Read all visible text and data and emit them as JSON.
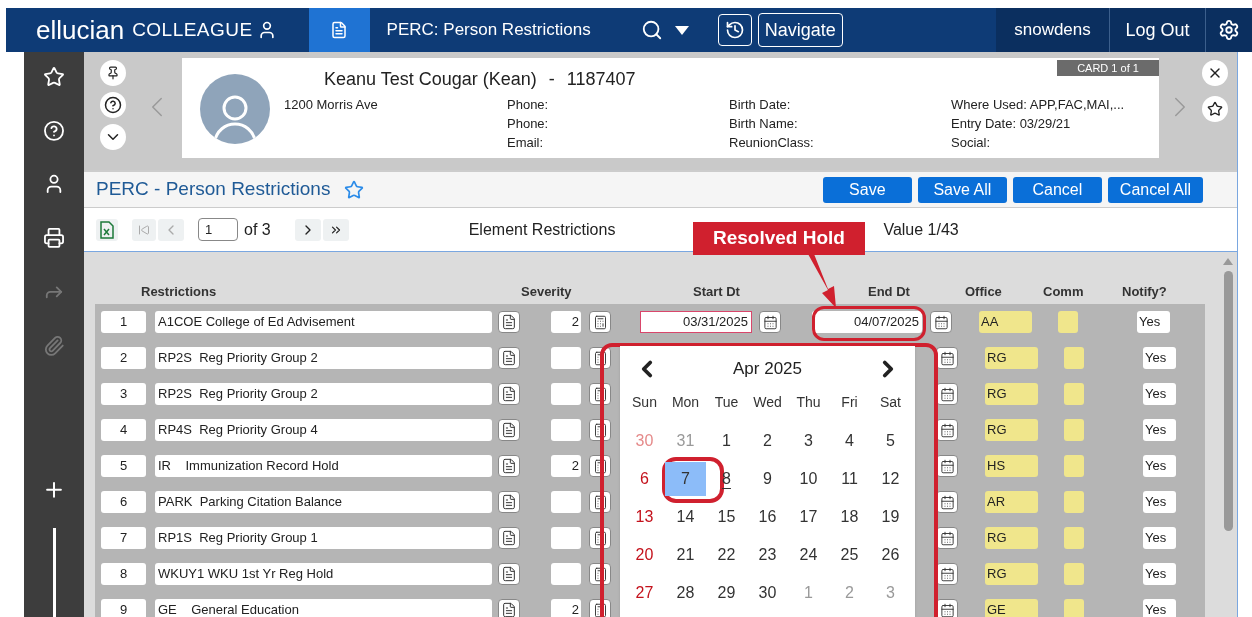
{
  "topbar": {
    "brand": "ellucian",
    "product": "COLLEAGUE",
    "form_title": "PERC: Person Restrictions",
    "navigate": "Navigate",
    "user": "snowdens",
    "logout": "Log Out"
  },
  "person": {
    "name": "Keanu Test Cougar (Kean)",
    "separator": "-",
    "id": "1187407",
    "card": "CARD 1 of 1",
    "address": "1200 Morris Ave",
    "columns": [
      [
        "Phone:",
        "Phone:",
        "Email:"
      ],
      [
        "Birth Date:",
        "Birth Name:",
        "ReunionClass:"
      ],
      [
        "Where Used: APP,FAC,MAI,...",
        "Entry Date: 03/29/21",
        "Social:"
      ]
    ]
  },
  "form": {
    "title": "PERC - Person Restrictions",
    "buttons": [
      "Save",
      "Save All",
      "Cancel",
      "Cancel All"
    ]
  },
  "pager": {
    "page": "1",
    "of": "of 3",
    "section": "Element Restrictions",
    "value": "Value 1/43"
  },
  "annotation": "Resolved Hold",
  "columns": [
    "Restrictions",
    "Severity",
    "Start Dt",
    "End Dt",
    "Office",
    "Comm",
    "Notify?"
  ],
  "rows": [
    {
      "num": "1",
      "restriction": "A1COE College of Ed Advisement",
      "severity": "2",
      "start_dt": "03/31/2025",
      "end_dt": "04/07/2025",
      "office": "AA",
      "notify": "Yes"
    },
    {
      "num": "2",
      "restriction": "RP2S  Reg Priority Group 2",
      "office": "RG",
      "notify": "Yes"
    },
    {
      "num": "3",
      "restriction": "RP2S  Reg Priority Group 2",
      "office": "RG",
      "notify": "Yes"
    },
    {
      "num": "4",
      "restriction": "RP4S  Reg Priority Group 4",
      "office": "RG",
      "notify": "Yes"
    },
    {
      "num": "5",
      "restriction": "IR    Immunization Record Hold",
      "severity": "2",
      "office": "HS",
      "notify": "Yes"
    },
    {
      "num": "6",
      "restriction": "PARK  Parking Citation Balance",
      "office": "AR",
      "notify": "Yes"
    },
    {
      "num": "7",
      "restriction": "RP1S  Reg Priority Group 1",
      "office": "RG",
      "notify": "Yes"
    },
    {
      "num": "8",
      "restriction": "WKUY1 WKU 1st Yr Reg Hold",
      "office": "RG",
      "notify": "Yes"
    },
    {
      "num": "9",
      "restriction": "GE    General Education",
      "severity": "2",
      "office": "GE",
      "notify": "Yes"
    }
  ],
  "calendar": {
    "month": "Apr 2025",
    "weekdays": [
      "Sun",
      "Mon",
      "Tue",
      "Wed",
      "Thu",
      "Fri",
      "Sat"
    ],
    "weeks": [
      [
        {
          "label": "30",
          "outside": true,
          "selected": false,
          "today": false
        },
        {
          "label": "31",
          "outside": true,
          "selected": false,
          "today": false
        },
        {
          "label": "1",
          "outside": false,
          "selected": false,
          "today": false
        },
        {
          "label": "2",
          "outside": false,
          "selected": false,
          "today": false
        },
        {
          "label": "3",
          "outside": false,
          "selected": false,
          "today": false
        },
        {
          "label": "4",
          "outside": false,
          "selected": false,
          "today": false
        },
        {
          "label": "5",
          "outside": false,
          "selected": false,
          "today": false
        }
      ],
      [
        {
          "label": "6",
          "outside": false,
          "selected": false,
          "today": false
        },
        {
          "label": "7",
          "outside": false,
          "selected": true,
          "today": false
        },
        {
          "label": "8",
          "outside": false,
          "selected": false,
          "today": true
        },
        {
          "label": "9",
          "outside": false,
          "selected": false,
          "today": false
        },
        {
          "label": "10",
          "outside": false,
          "selected": false,
          "today": false
        },
        {
          "label": "11",
          "outside": false,
          "selected": false,
          "today": false
        },
        {
          "label": "12",
          "outside": false,
          "selected": false,
          "today": false
        }
      ],
      [
        {
          "label": "13",
          "outside": false,
          "selected": false,
          "today": false
        },
        {
          "label": "14",
          "outside": false,
          "selected": false,
          "today": false
        },
        {
          "label": "15",
          "outside": false,
          "selected": false,
          "today": false
        },
        {
          "label": "16",
          "outside": false,
          "selected": false,
          "today": false
        },
        {
          "label": "17",
          "outside": false,
          "selected": false,
          "today": false
        },
        {
          "label": "18",
          "outside": false,
          "selected": false,
          "today": false
        },
        {
          "label": "19",
          "outside": false,
          "selected": false,
          "today": false
        }
      ],
      [
        {
          "label": "20",
          "outside": false,
          "selected": false,
          "today": false
        },
        {
          "label": "21",
          "outside": false,
          "selected": false,
          "today": false
        },
        {
          "label": "22",
          "outside": false,
          "selected": false,
          "today": false
        },
        {
          "label": "23",
          "outside": false,
          "selected": false,
          "today": false
        },
        {
          "label": "24",
          "outside": false,
          "selected": false,
          "today": false
        },
        {
          "label": "25",
          "outside": false,
          "selected": false,
          "today": false
        },
        {
          "label": "26",
          "outside": false,
          "selected": false,
          "today": false
        }
      ],
      [
        {
          "label": "27",
          "outside": false,
          "selected": false,
          "today": false
        },
        {
          "label": "28",
          "outside": false,
          "selected": false,
          "today": false
        },
        {
          "label": "29",
          "outside": false,
          "selected": false,
          "today": false
        },
        {
          "label": "30",
          "outside": false,
          "selected": false,
          "today": false
        },
        {
          "label": "1",
          "outside": true,
          "selected": false,
          "today": false
        },
        {
          "label": "2",
          "outside": true,
          "selected": false,
          "today": false
        },
        {
          "label": "3",
          "outside": true,
          "selected": false,
          "today": false
        }
      ]
    ]
  }
}
